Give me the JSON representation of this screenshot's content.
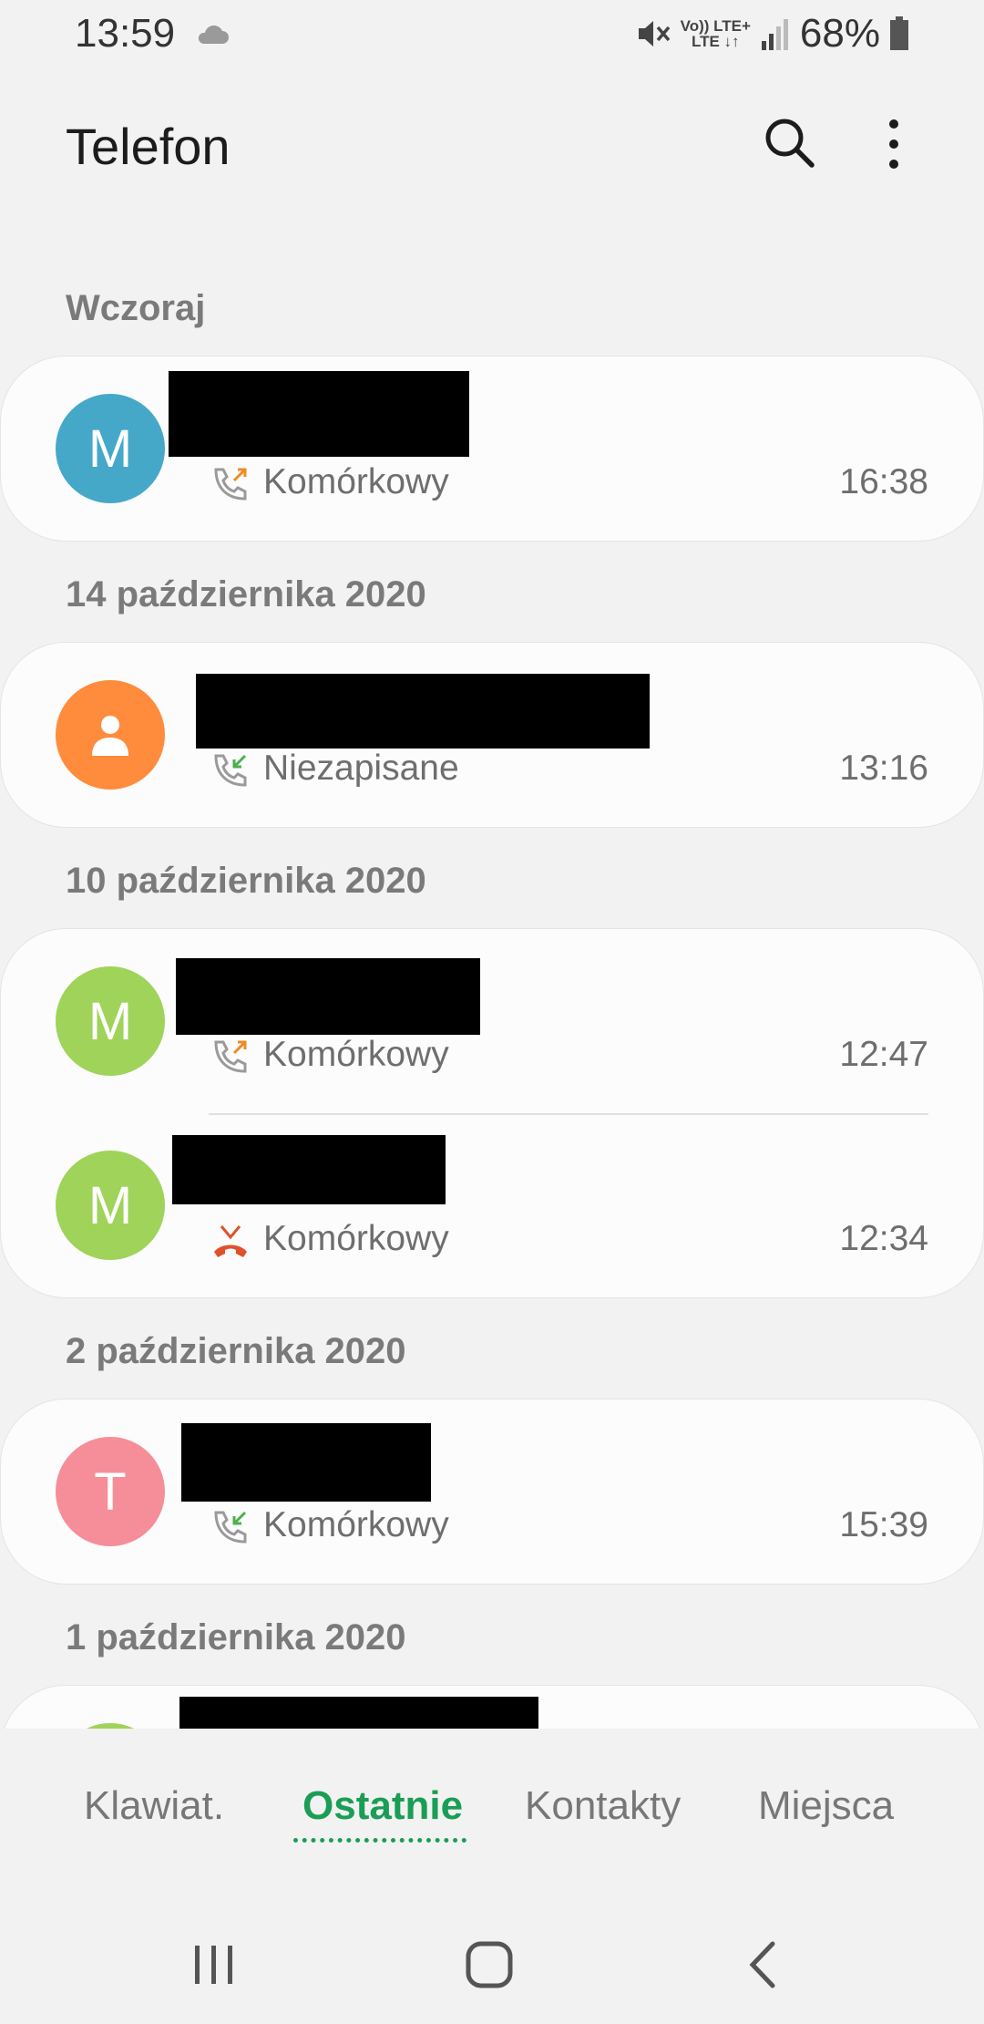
{
  "status_bar": {
    "time": "13:59",
    "lte_top": "Vo)) LTE+",
    "lte_bottom": "LTE ↓↑",
    "battery": "68%"
  },
  "app_bar": {
    "title": "Telefon",
    "search_icon": "search-icon",
    "more_icon": "more-options-icon"
  },
  "groups": [
    {
      "header": "Wczoraj",
      "calls": [
        {
          "avatar_letter": "M",
          "avatar_color": "#45a8c9",
          "direction": "outgoing",
          "type": "Komórkowy",
          "time": "16:38"
        }
      ]
    },
    {
      "header": "14 października 2020",
      "calls": [
        {
          "avatar_letter": "",
          "avatar_color": "#ff8b3d",
          "direction": "incoming",
          "type": "Niezapisane",
          "time": "13:16"
        }
      ]
    },
    {
      "header": "10 października 2020",
      "calls": [
        {
          "avatar_letter": "M",
          "avatar_color": "#9fd35a",
          "direction": "outgoing",
          "type": "Komórkowy",
          "time": "12:47"
        },
        {
          "avatar_letter": "M",
          "avatar_color": "#9fd35a",
          "direction": "missed",
          "type": "Komórkowy",
          "time": "12:34"
        }
      ]
    },
    {
      "header": "2 października 2020",
      "calls": [
        {
          "avatar_letter": "T",
          "avatar_color": "#f58e99",
          "direction": "incoming",
          "type": "Komórkowy",
          "time": "15:39"
        }
      ]
    },
    {
      "header": "1 października 2020",
      "calls": []
    }
  ],
  "tabs": {
    "keypad": "Klawiat.",
    "recents": "Ostatnie",
    "contacts": "Kontakty",
    "places": "Miejsca"
  },
  "colors": {
    "accent": "#1a9e55",
    "outgoing": "#f08a24",
    "incoming": "#4caf50",
    "missed": "#e0502a"
  }
}
